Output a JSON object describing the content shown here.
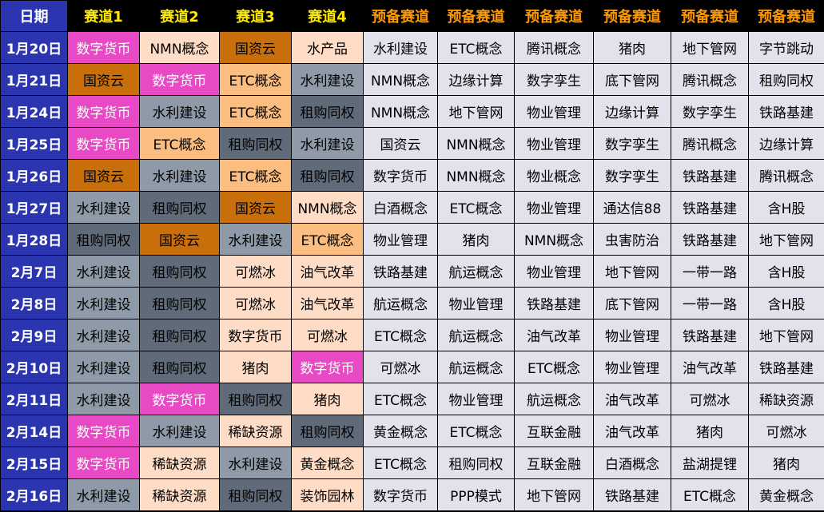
{
  "headers": [
    "日期",
    "赛道1",
    "赛道2",
    "赛道3",
    "赛道4",
    "预备赛道",
    "预备赛道",
    "预备赛道",
    "预备赛道",
    "预备赛道",
    "预备赛道"
  ],
  "rows": [
    {
      "date": "1月20日",
      "cells": [
        [
          "数字货币",
          "pink"
        ],
        [
          "NMN概念",
          "peach"
        ],
        [
          "国资云",
          "brown"
        ],
        [
          "水产品",
          "peach"
        ],
        [
          "水利建设",
          "lav"
        ],
        [
          "ETC概念",
          "lav"
        ],
        [
          "腾讯概念",
          "lav"
        ],
        [
          "猪肉",
          "lav"
        ],
        [
          "地下管网",
          "lav"
        ],
        [
          "字节跳动",
          "lav"
        ]
      ]
    },
    {
      "date": "1月21日",
      "cells": [
        [
          "国资云",
          "brown"
        ],
        [
          "数字货币",
          "pink"
        ],
        [
          "ETC概念",
          "orange"
        ],
        [
          "水利建设",
          "gray"
        ],
        [
          "NMN概念",
          "lav"
        ],
        [
          "边缘计算",
          "lav"
        ],
        [
          "数字孪生",
          "lav"
        ],
        [
          "底下管网",
          "lav"
        ],
        [
          "腾讯概念",
          "lav"
        ],
        [
          "租购同权",
          "lav"
        ]
      ]
    },
    {
      "date": "1月24日",
      "cells": [
        [
          "数字货币",
          "pink"
        ],
        [
          "水利建设",
          "gray"
        ],
        [
          "ETC概念",
          "orange"
        ],
        [
          "租购同权",
          "slate"
        ],
        [
          "NMN概念",
          "lav"
        ],
        [
          "地下管网",
          "lav"
        ],
        [
          "物业管理",
          "lav"
        ],
        [
          "边缘计算",
          "lav"
        ],
        [
          "数字孪生",
          "lav"
        ],
        [
          "铁路基建",
          "lav"
        ]
      ]
    },
    {
      "date": "1月25日",
      "cells": [
        [
          "数字货币",
          "pink"
        ],
        [
          "ETC概念",
          "orange"
        ],
        [
          "租购同权",
          "slate"
        ],
        [
          "水利建设",
          "gray"
        ],
        [
          "国资云",
          "lav"
        ],
        [
          "NMN概念",
          "lav"
        ],
        [
          "物业管理",
          "lav"
        ],
        [
          "数字孪生",
          "lav"
        ],
        [
          "腾讯概念",
          "lav"
        ],
        [
          "边缘计算",
          "lav"
        ]
      ]
    },
    {
      "date": "1月26日",
      "cells": [
        [
          "国资云",
          "brown"
        ],
        [
          "水利建设",
          "gray"
        ],
        [
          "ETC概念",
          "orange"
        ],
        [
          "租购同权",
          "slate"
        ],
        [
          "数字货币",
          "lav"
        ],
        [
          "NMN概念",
          "lav"
        ],
        [
          "物业概念",
          "lav"
        ],
        [
          "数字孪生",
          "lav"
        ],
        [
          "铁路基建",
          "lav"
        ],
        [
          "腾讯概念",
          "lav"
        ]
      ]
    },
    {
      "date": "1月27日",
      "cells": [
        [
          "水利建设",
          "gray"
        ],
        [
          "租购同权",
          "slate"
        ],
        [
          "国资云",
          "brown"
        ],
        [
          "NMN概念",
          "peach"
        ],
        [
          "白酒概念",
          "lav"
        ],
        [
          "ETC概念",
          "lav"
        ],
        [
          "物业管理",
          "lav"
        ],
        [
          "通达信88",
          "lav"
        ],
        [
          "铁路基建",
          "lav"
        ],
        [
          "含H股",
          "lav"
        ]
      ]
    },
    {
      "date": "1月28日",
      "cells": [
        [
          "租购同权",
          "slate"
        ],
        [
          "国资云",
          "brown"
        ],
        [
          "水利建设",
          "gray"
        ],
        [
          "ETC概念",
          "orange"
        ],
        [
          "物业管理",
          "lav"
        ],
        [
          "猪肉",
          "lav"
        ],
        [
          "NMN概念",
          "lav"
        ],
        [
          "虫害防治",
          "lav"
        ],
        [
          "铁路基建",
          "lav"
        ],
        [
          "地下管网",
          "lav"
        ]
      ]
    },
    {
      "date": "2月7日",
      "cells": [
        [
          "水利建设",
          "gray"
        ],
        [
          "租购同权",
          "slate"
        ],
        [
          "可燃冰",
          "peach"
        ],
        [
          "油气改革",
          "peach"
        ],
        [
          "铁路基建",
          "lav"
        ],
        [
          "航运概念",
          "lav"
        ],
        [
          "物业管理",
          "lav"
        ],
        [
          "地下管网",
          "lav"
        ],
        [
          "一带一路",
          "lav"
        ],
        [
          "含H股",
          "lav"
        ]
      ]
    },
    {
      "date": "2月8日",
      "cells": [
        [
          "水利建设",
          "gray"
        ],
        [
          "租购同权",
          "slate"
        ],
        [
          "可燃冰",
          "peach"
        ],
        [
          "油气改革",
          "peach"
        ],
        [
          "航运概念",
          "lav"
        ],
        [
          "物业管理",
          "lav"
        ],
        [
          "铁路基建",
          "lav"
        ],
        [
          "底下管网",
          "lav"
        ],
        [
          "一带一路",
          "lav"
        ],
        [
          "含H股",
          "lav"
        ]
      ]
    },
    {
      "date": "2月9日",
      "cells": [
        [
          "水利建设",
          "gray"
        ],
        [
          "租购同权",
          "slate"
        ],
        [
          "数字货币",
          "peach"
        ],
        [
          "可燃冰",
          "peach"
        ],
        [
          "ETC概念",
          "lav"
        ],
        [
          "航运概念",
          "lav"
        ],
        [
          "油气改革",
          "lav"
        ],
        [
          "物业管理",
          "lav"
        ],
        [
          "铁路基建",
          "lav"
        ],
        [
          "地下管网",
          "lav"
        ]
      ]
    },
    {
      "date": "2月10日",
      "cells": [
        [
          "水利建设",
          "gray"
        ],
        [
          "租购同权",
          "slate"
        ],
        [
          "猪肉",
          "peach"
        ],
        [
          "数字货币",
          "pink"
        ],
        [
          "可燃冰",
          "lav"
        ],
        [
          "航运概念",
          "lav"
        ],
        [
          "ETC概念",
          "lav"
        ],
        [
          "物业管理",
          "lav"
        ],
        [
          "油气改革",
          "lav"
        ],
        [
          "铁路基建",
          "lav"
        ]
      ]
    },
    {
      "date": "2月11日",
      "cells": [
        [
          "水利建设",
          "gray"
        ],
        [
          "数字货币",
          "pink"
        ],
        [
          "租购同权",
          "slate"
        ],
        [
          "猪肉",
          "peach"
        ],
        [
          "ETC概念",
          "lav"
        ],
        [
          "物业管理",
          "lav"
        ],
        [
          "航运概念",
          "lav"
        ],
        [
          "油气改革",
          "lav"
        ],
        [
          "可燃冰",
          "lav"
        ],
        [
          "稀缺资源",
          "lav"
        ]
      ]
    },
    {
      "date": "2月14日",
      "cells": [
        [
          "数字货币",
          "pink"
        ],
        [
          "水利建设",
          "gray"
        ],
        [
          "稀缺资源",
          "peach"
        ],
        [
          "租购同权",
          "slate"
        ],
        [
          "黄金概念",
          "lav"
        ],
        [
          "ETC概念",
          "lav"
        ],
        [
          "互联金融",
          "lav"
        ],
        [
          "油气改革",
          "lav"
        ],
        [
          "猪肉",
          "lav"
        ],
        [
          "可燃冰",
          "lav"
        ]
      ]
    },
    {
      "date": "2月15日",
      "cells": [
        [
          "数字货币",
          "pink"
        ],
        [
          "稀缺资源",
          "peach"
        ],
        [
          "水利建设",
          "gray"
        ],
        [
          "黄金概念",
          "peach"
        ],
        [
          "ETC概念",
          "lav"
        ],
        [
          "租购同权",
          "lav"
        ],
        [
          "互联金融",
          "lav"
        ],
        [
          "白酒概念",
          "lav"
        ],
        [
          "盐湖提锂",
          "lav"
        ],
        [
          "猪肉",
          "lav"
        ]
      ]
    },
    {
      "date": "2月16日",
      "cells": [
        [
          "水利建设",
          "gray"
        ],
        [
          "稀缺资源",
          "peach"
        ],
        [
          "租购同权",
          "slate"
        ],
        [
          "装饰园林",
          "peach"
        ],
        [
          "数字货币",
          "lav"
        ],
        [
          "PPP模式",
          "lav"
        ],
        [
          "地下管网",
          "lav"
        ],
        [
          "铁路基建",
          "lav"
        ],
        [
          "ETC概念",
          "lav"
        ],
        [
          "黄金概念",
          "lav"
        ]
      ]
    }
  ],
  "colors": {
    "date_bg": "#2b35b0",
    "track_header": "#ffea00",
    "backup_header": "#ff9900",
    "pink": "#e849c4",
    "brown": "#c86f0c",
    "orange": "#fbbe80",
    "peach": "#ffdcc6",
    "slate": "#5f6b79",
    "gray": "#8e9aa7",
    "lav": "#e3e1eb"
  }
}
